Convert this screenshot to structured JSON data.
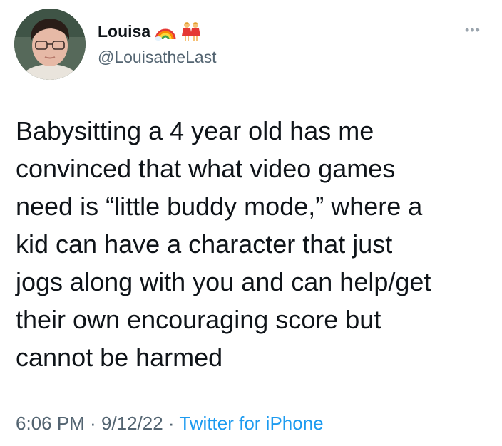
{
  "author": {
    "display_name": "Louisa",
    "handle": "@LouisatheLast",
    "name_emojis": [
      "rainbow-icon",
      "two-women-holding-hands-icon"
    ]
  },
  "menu": {
    "more_label": "•••"
  },
  "tweet": {
    "lines": [
      "Babysitting a 4 year old has me",
      "convinced that what video games",
      "need is “little buddy mode,” where a",
      "kid can have a character that just",
      "jogs along with you and can help/get",
      "their own encouraging score but",
      "cannot be harmed"
    ]
  },
  "meta": {
    "time": "6:06 PM",
    "sep1": " · ",
    "date": "9/12/22",
    "sep2": " · ",
    "source": "Twitter for iPhone"
  },
  "colors": {
    "text": "#0f1419",
    "secondary": "#536471",
    "link": "#1d9bf0"
  }
}
